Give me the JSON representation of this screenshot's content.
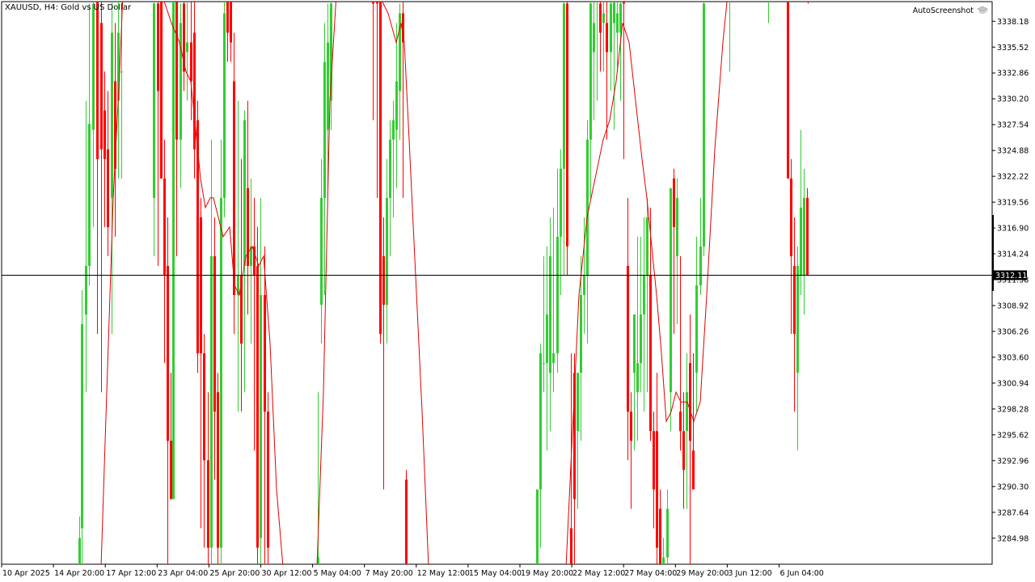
{
  "symbol": {
    "ticker": "XAUUSD, H4:",
    "description": "Gold vs US Dollar"
  },
  "tool_label": "AutoScreenshot",
  "icons": {
    "tool": "graduation-cap-icon"
  },
  "colors": {
    "bull": "#32cd32",
    "bear": "#ff0000",
    "ma": "#e00000",
    "bid_line": "#000000",
    "background": "#ffffff",
    "price_tag_bg": "#000000",
    "price_tag_text": "#ffffff"
  },
  "current_price": {
    "value": 3312.11,
    "label": "3312.11"
  },
  "price_axis": {
    "ticks": [
      "3338.18",
      "3335.52",
      "3332.86",
      "3330.20",
      "3327.54",
      "3324.88",
      "3322.22",
      "3319.56",
      "3316.90",
      "3314.24",
      "3311.58",
      "3308.92",
      "3306.26",
      "3303.60",
      "3300.94",
      "3298.28",
      "3295.62",
      "3292.96",
      "3290.30",
      "3287.64",
      "3284.98"
    ]
  },
  "time_axis": {
    "ticks": [
      "10 Apr 2025",
      "14 Apr 20:00",
      "17 Apr 12:00",
      "23 Apr 04:00",
      "25 Apr 20:00",
      "30 Apr 12:00",
      "5 May 04:00",
      "7 May 20:00",
      "12 May 12:00",
      "15 May 04:00",
      "19 May 20:00",
      "22 May 12:00",
      "27 May 04:00",
      "29 May 20:00",
      "3 Jun 12:00",
      "6 Jun 04:00"
    ]
  },
  "chart_data": {
    "type": "candlestick",
    "symbol": "XAUUSD",
    "timeframe": "H4",
    "ylim": [
      3282.3,
      3340.2
    ],
    "candles": [
      {
        "x": 98,
        "o": 3282,
        "h": 3287.2,
        "l": 3282,
        "c": 3285
      },
      {
        "x": 101,
        "o": 3286,
        "h": 3310.5,
        "l": 3282,
        "c": 3307
      },
      {
        "x": 106,
        "o": 3308,
        "h": 3330,
        "l": 3300,
        "c": 3313
      },
      {
        "x": 110,
        "o": 3313,
        "h": 3340,
        "l": 3311,
        "c": 3327.6
      },
      {
        "x": 115,
        "o": 3327,
        "h": 3341,
        "l": 3317,
        "c": 3340
      },
      {
        "x": 120,
        "o": 3341,
        "h": 3342,
        "l": 3306,
        "c": 3324
      },
      {
        "x": 125,
        "o": 3338,
        "h": 3341,
        "l": 3300,
        "c": 3325
      },
      {
        "x": 129,
        "o": 3329,
        "h": 3333,
        "l": 3317,
        "c": 3324
      },
      {
        "x": 133,
        "o": 3325,
        "h": 3331,
        "l": 3314,
        "c": 3317
      },
      {
        "x": 138,
        "o": 3320,
        "h": 3341,
        "l": 3306,
        "c": 3337
      },
      {
        "x": 142,
        "o": 3332,
        "h": 3338,
        "l": 3316,
        "c": 3323
      },
      {
        "x": 146,
        "o": 3330,
        "h": 3341,
        "l": 3322,
        "c": 3337
      },
      {
        "x": 150,
        "o": 3333,
        "h": 3341,
        "l": 3322,
        "c": 3333
      },
      {
        "x": 190,
        "o": 3320,
        "h": 3341,
        "l": 3314,
        "c": 3340
      },
      {
        "x": 195,
        "o": 3340,
        "h": 3341,
        "l": 3313,
        "c": 3331
      },
      {
        "x": 199,
        "o": 3341,
        "h": 3342,
        "l": 3322,
        "c": 3322
      },
      {
        "x": 203,
        "o": 3322,
        "h": 3326,
        "l": 3303,
        "c": 3312
      },
      {
        "x": 207,
        "o": 3313,
        "h": 3318,
        "l": 3282,
        "c": 3295
      },
      {
        "x": 211,
        "o": 3295,
        "h": 3302,
        "l": 3289,
        "c": 3289
      },
      {
        "x": 214,
        "o": 3289,
        "h": 3341,
        "l": 3289,
        "c": 3341
      },
      {
        "x": 218,
        "o": 3341,
        "h": 3342,
        "l": 3314,
        "c": 3326
      },
      {
        "x": 223,
        "o": 3326,
        "h": 3340,
        "l": 3321,
        "c": 3338
      },
      {
        "x": 227,
        "o": 3340,
        "h": 3341,
        "l": 3331,
        "c": 3333
      },
      {
        "x": 231,
        "o": 3335,
        "h": 3341,
        "l": 3330,
        "c": 3336
      },
      {
        "x": 236,
        "o": 3336,
        "h": 3341,
        "l": 3328,
        "c": 3332
      },
      {
        "x": 240,
        "o": 3337,
        "h": 3341,
        "l": 3322,
        "c": 3325
      },
      {
        "x": 244,
        "o": 3328,
        "h": 3330,
        "l": 3302,
        "c": 3304
      },
      {
        "x": 248,
        "o": 3318,
        "h": 3320,
        "l": 3286,
        "c": 3304
      },
      {
        "x": 252,
        "o": 3304,
        "h": 3306,
        "l": 3284,
        "c": 3293
      },
      {
        "x": 257,
        "o": 3293,
        "h": 3300,
        "l": 3282,
        "c": 3284
      },
      {
        "x": 261,
        "o": 3284,
        "h": 3326,
        "l": 3282,
        "c": 3314
      },
      {
        "x": 265,
        "o": 3314,
        "h": 3318,
        "l": 3291,
        "c": 3298
      },
      {
        "x": 269,
        "o": 3300,
        "h": 3302,
        "l": 3282,
        "c": 3284
      },
      {
        "x": 273,
        "o": 3284,
        "h": 3326,
        "l": 3282,
        "c": 3320
      },
      {
        "x": 277,
        "o": 3320,
        "h": 3341,
        "l": 3318,
        "c": 3339
      },
      {
        "x": 281,
        "o": 3341,
        "h": 3342,
        "l": 3334,
        "c": 3337
      },
      {
        "x": 285,
        "o": 3341,
        "h": 3342,
        "l": 3334,
        "c": 3336
      },
      {
        "x": 289,
        "o": 3332,
        "h": 3337,
        "l": 3306,
        "c": 3310
      },
      {
        "x": 294,
        "o": 3310,
        "h": 3330,
        "l": 3298,
        "c": 3312
      },
      {
        "x": 298,
        "o": 3312,
        "h": 3324,
        "l": 3298,
        "c": 3305
      },
      {
        "x": 302,
        "o": 3313,
        "h": 3329,
        "l": 3300,
        "c": 3328
      },
      {
        "x": 306,
        "o": 3321,
        "h": 3330,
        "l": 3308,
        "c": 3313
      },
      {
        "x": 310,
        "o": 3313,
        "h": 3322,
        "l": 3305,
        "c": 3315
      },
      {
        "x": 314,
        "o": 3315,
        "h": 3320,
        "l": 3294,
        "c": 3312
      },
      {
        "x": 318,
        "o": 3313,
        "h": 3317,
        "l": 3282,
        "c": 3284
      },
      {
        "x": 322,
        "o": 3285,
        "h": 3320,
        "l": 3282,
        "c": 3310
      },
      {
        "x": 327,
        "o": 3310,
        "h": 3315,
        "l": 3282,
        "c": 3298
      },
      {
        "x": 331,
        "o": 3298,
        "h": 3300,
        "l": 3282,
        "c": 3284
      },
      {
        "x": 393,
        "o": 3282,
        "h": 3300,
        "l": 3282,
        "c": 3283
      },
      {
        "x": 397,
        "o": 3309,
        "h": 3324,
        "l": 3305,
        "c": 3320
      },
      {
        "x": 401,
        "o": 3320,
        "h": 3338,
        "l": 3310,
        "c": 3334
      },
      {
        "x": 405,
        "o": 3327,
        "h": 3340,
        "l": 3321,
        "c": 3336
      },
      {
        "x": 409,
        "o": 3330,
        "h": 3341,
        "l": 3327,
        "c": 3340
      },
      {
        "x": 461,
        "o": 3341,
        "h": 3342,
        "l": 3328,
        "c": 3340
      },
      {
        "x": 466,
        "o": 3341,
        "h": 3342,
        "l": 3320,
        "c": 3340
      },
      {
        "x": 470,
        "o": 3341,
        "h": 3342,
        "l": 3305,
        "c": 3306
      },
      {
        "x": 474,
        "o": 3314,
        "h": 3318,
        "l": 3290,
        "c": 3309
      },
      {
        "x": 478,
        "o": 3309,
        "h": 3324,
        "l": 3305,
        "c": 3320
      },
      {
        "x": 482,
        "o": 3320,
        "h": 3328,
        "l": 3314,
        "c": 3326
      },
      {
        "x": 486,
        "o": 3326,
        "h": 3330,
        "l": 3318,
        "c": 3328
      },
      {
        "x": 490,
        "o": 3327,
        "h": 3338,
        "l": 3321,
        "c": 3332
      },
      {
        "x": 494,
        "o": 3331,
        "h": 3340,
        "l": 3326,
        "c": 3339
      },
      {
        "x": 498,
        "o": 3339,
        "h": 3341,
        "l": 3320,
        "c": 3336
      },
      {
        "x": 502,
        "o": 3291,
        "h": 3292,
        "l": 3282,
        "c": 3282
      },
      {
        "x": 664,
        "o": 3282,
        "h": 3290,
        "l": 3282,
        "c": 3290
      },
      {
        "x": 668,
        "o": 3290,
        "h": 3305,
        "l": 3284,
        "c": 3304
      },
      {
        "x": 672,
        "o": 3303,
        "h": 3314,
        "l": 3300,
        "c": 3303
      },
      {
        "x": 676,
        "o": 3303,
        "h": 3315,
        "l": 3294,
        "c": 3308
      },
      {
        "x": 680,
        "o": 3302,
        "h": 3318,
        "l": 3296,
        "c": 3314
      },
      {
        "x": 684,
        "o": 3303,
        "h": 3319,
        "l": 3300,
        "c": 3304
      },
      {
        "x": 689,
        "o": 3304,
        "h": 3323,
        "l": 3302,
        "c": 3316
      },
      {
        "x": 693,
        "o": 3316,
        "h": 3325,
        "l": 3310,
        "c": 3323
      },
      {
        "x": 697,
        "o": 3323,
        "h": 3341,
        "l": 3312,
        "c": 3340
      },
      {
        "x": 701,
        "o": 3340,
        "h": 3342,
        "l": 3312,
        "c": 3315
      },
      {
        "x": 706,
        "o": 3286,
        "h": 3304,
        "l": 3282,
        "c": 3282
      },
      {
        "x": 710,
        "o": 3302,
        "h": 3304,
        "l": 3282,
        "c": 3289
      },
      {
        "x": 714,
        "o": 3296,
        "h": 3302,
        "l": 3288,
        "c": 3302
      },
      {
        "x": 718,
        "o": 3302,
        "h": 3314,
        "l": 3295,
        "c": 3310
      },
      {
        "x": 722,
        "o": 3310,
        "h": 3318,
        "l": 3306,
        "c": 3312
      },
      {
        "x": 726,
        "o": 3312,
        "h": 3328,
        "l": 3305,
        "c": 3326
      },
      {
        "x": 730,
        "o": 3326,
        "h": 3341,
        "l": 3320,
        "c": 3340
      },
      {
        "x": 734,
        "o": 3335,
        "h": 3341,
        "l": 3328,
        "c": 3338
      },
      {
        "x": 738,
        "o": 3341,
        "h": 3342,
        "l": 3330,
        "c": 3341
      },
      {
        "x": 742,
        "o": 3340,
        "h": 3342,
        "l": 3333,
        "c": 3337
      },
      {
        "x": 746,
        "o": 3338,
        "h": 3341,
        "l": 3333,
        "c": 3339
      },
      {
        "x": 750,
        "o": 3338,
        "h": 3341,
        "l": 3326,
        "c": 3335
      },
      {
        "x": 755,
        "o": 3335,
        "h": 3341,
        "l": 3331,
        "c": 3340
      },
      {
        "x": 759,
        "o": 3338,
        "h": 3341,
        "l": 3327,
        "c": 3341
      },
      {
        "x": 763,
        "o": 3337,
        "h": 3341,
        "l": 3333,
        "c": 3339
      },
      {
        "x": 767,
        "o": 3337,
        "h": 3341,
        "l": 3330,
        "c": 3340
      },
      {
        "x": 771,
        "o": 3341,
        "h": 3342,
        "l": 3324,
        "c": 3340
      },
      {
        "x": 776,
        "o": 3313,
        "h": 3320,
        "l": 3293,
        "c": 3298
      },
      {
        "x": 780,
        "o": 3298,
        "h": 3300,
        "l": 3288,
        "c": 3295
      },
      {
        "x": 784,
        "o": 3302,
        "h": 3308,
        "l": 3294,
        "c": 3308
      },
      {
        "x": 788,
        "o": 3300,
        "h": 3316,
        "l": 3295,
        "c": 3303
      },
      {
        "x": 792,
        "o": 3303,
        "h": 3316,
        "l": 3300,
        "c": 3308
      },
      {
        "x": 796,
        "o": 3308,
        "h": 3318,
        "l": 3298,
        "c": 3312
      },
      {
        "x": 800,
        "o": 3312,
        "h": 3320,
        "l": 3300,
        "c": 3318
      },
      {
        "x": 804,
        "o": 3312,
        "h": 3319,
        "l": 3295,
        "c": 3296
      },
      {
        "x": 808,
        "o": 3296,
        "h": 3298,
        "l": 3286,
        "c": 3290
      },
      {
        "x": 812,
        "o": 3296,
        "h": 3302,
        "l": 3282,
        "c": 3284
      },
      {
        "x": 816,
        "o": 3288,
        "h": 3290,
        "l": 3282,
        "c": 3282
      },
      {
        "x": 820,
        "o": 3282,
        "h": 3285,
        "l": 3282,
        "c": 3283
      },
      {
        "x": 825,
        "o": 3283,
        "h": 3290,
        "l": 3282,
        "c": 3288
      },
      {
        "x": 829,
        "o": 3300,
        "h": 3312,
        "l": 3296,
        "c": 3321
      },
      {
        "x": 833,
        "o": 3322,
        "h": 3323,
        "l": 3306,
        "c": 3317
      },
      {
        "x": 837,
        "o": 3314,
        "h": 3322,
        "l": 3307,
        "c": 3320
      },
      {
        "x": 841,
        "o": 3298,
        "h": 3314,
        "l": 3294,
        "c": 3296
      },
      {
        "x": 845,
        "o": 3296,
        "h": 3300,
        "l": 3288,
        "c": 3292
      },
      {
        "x": 849,
        "o": 3296,
        "h": 3304,
        "l": 3288,
        "c": 3300
      },
      {
        "x": 853,
        "o": 3303,
        "h": 3308,
        "l": 3282,
        "c": 3295
      },
      {
        "x": 857,
        "o": 3294,
        "h": 3304,
        "l": 3290,
        "c": 3290
      },
      {
        "x": 861,
        "o": 3302,
        "h": 3316,
        "l": 3298,
        "c": 3311
      },
      {
        "x": 866,
        "o": 3311,
        "h": 3320,
        "l": 3310,
        "c": 3315
      },
      {
        "x": 870,
        "o": 3315,
        "h": 3341,
        "l": 3314,
        "c": 3340
      },
      {
        "x": 902,
        "o": 3341,
        "h": 3342,
        "l": 3333,
        "c": 3341
      },
      {
        "x": 950,
        "o": 3341,
        "h": 3342,
        "l": 3338,
        "c": 3341
      },
      {
        "x": 974,
        "o": 3341,
        "h": 3342,
        "l": 3322,
        "c": 3322
      },
      {
        "x": 978,
        "o": 3322,
        "h": 3324,
        "l": 3306,
        "c": 3314
      },
      {
        "x": 982,
        "o": 3313,
        "h": 3318,
        "l": 3298,
        "c": 3306
      },
      {
        "x": 986,
        "o": 3302,
        "h": 3315,
        "l": 3294,
        "c": 3313
      },
      {
        "x": 990,
        "o": 3312,
        "h": 3327,
        "l": 3310,
        "c": 3319
      },
      {
        "x": 994,
        "o": 3312,
        "h": 3323,
        "l": 3308,
        "c": 3320
      },
      {
        "x": 998,
        "o": 3320,
        "h": 3321,
        "l": 3312,
        "c": 3312
      }
    ],
    "moving_average": [
      [
        125,
        3282
      ],
      [
        132,
        3300
      ],
      [
        140,
        3320
      ],
      [
        148,
        3333
      ],
      [
        152,
        3341
      ],
      [
        180,
        3341
      ],
      [
        196,
        3341
      ],
      [
        204,
        3340
      ],
      [
        212,
        3338
      ],
      [
        222,
        3336
      ],
      [
        230,
        3333
      ],
      [
        236,
        3332
      ],
      [
        242,
        3327
      ],
      [
        248,
        3322
      ],
      [
        254,
        3319
      ],
      [
        260,
        3320
      ],
      [
        264,
        3320
      ],
      [
        270,
        3318
      ],
      [
        276,
        3316
      ],
      [
        284,
        3317
      ],
      [
        290,
        3311
      ],
      [
        296,
        3310
      ],
      [
        304,
        3314
      ],
      [
        312,
        3315
      ],
      [
        320,
        3313
      ],
      [
        326,
        3314
      ],
      [
        334,
        3305
      ],
      [
        342,
        3290
      ],
      [
        350,
        3282
      ],
      [
        392,
        3282
      ],
      [
        400,
        3300
      ],
      [
        408,
        3330
      ],
      [
        416,
        3341
      ],
      [
        428,
        3341
      ],
      [
        456,
        3341
      ],
      [
        468,
        3341
      ],
      [
        480,
        3339
      ],
      [
        490,
        3336
      ],
      [
        496,
        3338
      ],
      [
        500,
        3336
      ],
      [
        506,
        3326
      ],
      [
        514,
        3312
      ],
      [
        522,
        3298
      ],
      [
        530,
        3282
      ],
      [
        700,
        3282
      ],
      [
        708,
        3296
      ],
      [
        716,
        3310
      ],
      [
        726,
        3318
      ],
      [
        736,
        3322
      ],
      [
        746,
        3326
      ],
      [
        754,
        3328
      ],
      [
        762,
        3332
      ],
      [
        770,
        3338
      ],
      [
        778,
        3336
      ],
      [
        786,
        3330
      ],
      [
        794,
        3324
      ],
      [
        800,
        3320
      ],
      [
        806,
        3315
      ],
      [
        812,
        3310
      ],
      [
        818,
        3304
      ],
      [
        824,
        3297
      ],
      [
        830,
        3298
      ],
      [
        836,
        3300
      ],
      [
        842,
        3299
      ],
      [
        850,
        3299
      ],
      [
        858,
        3297
      ],
      [
        866,
        3299
      ],
      [
        874,
        3310
      ],
      [
        884,
        3325
      ],
      [
        894,
        3336
      ],
      [
        900,
        3341
      ],
      [
        994,
        3341
      ],
      [
        1000,
        3340
      ]
    ]
  }
}
